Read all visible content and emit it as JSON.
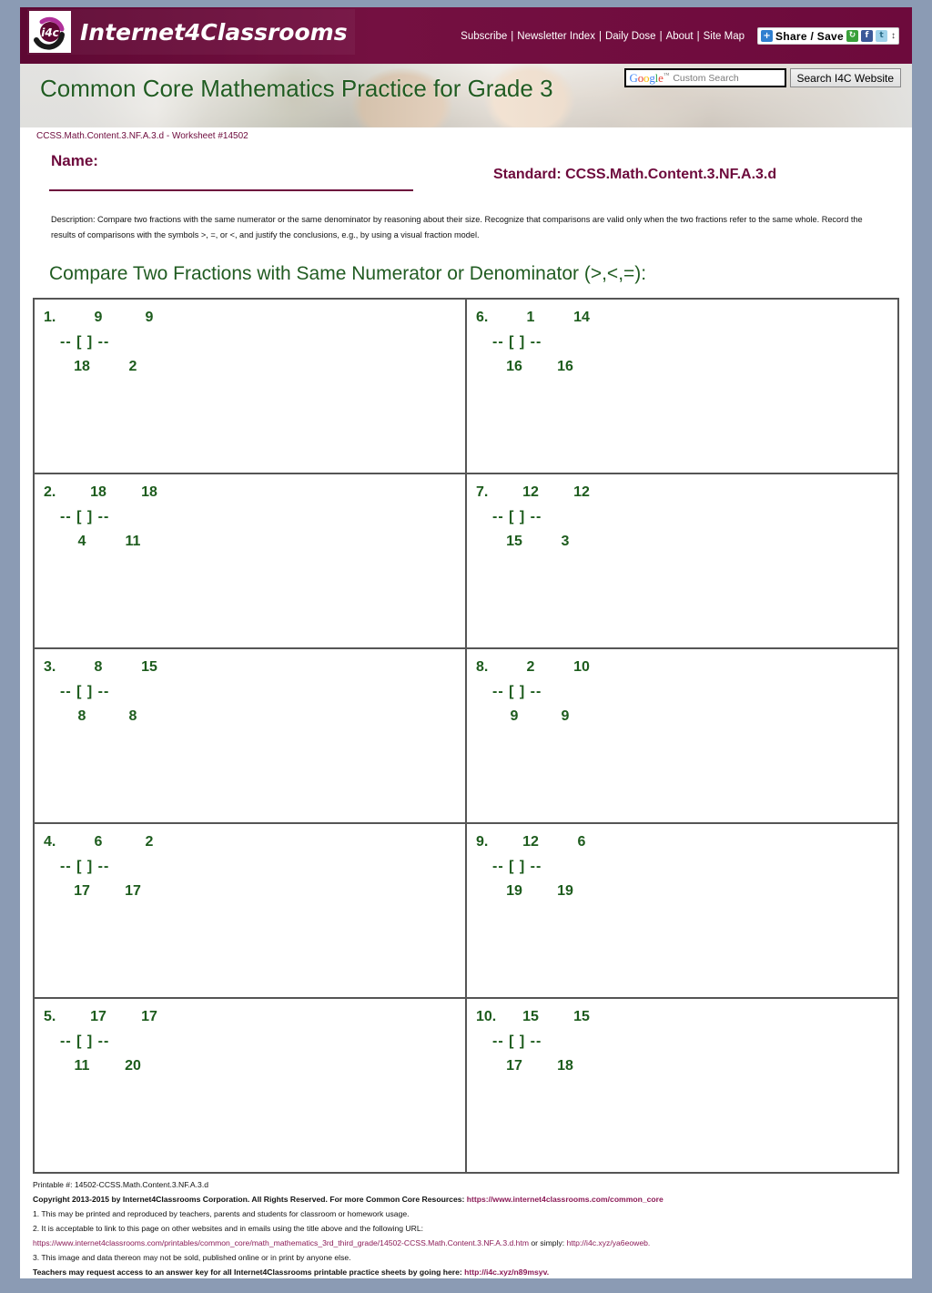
{
  "site": {
    "logo_text": "Internet4Classrooms",
    "logo_badge": "i4c",
    "nav": [
      {
        "label": "Subscribe"
      },
      {
        "label": "Newsletter Index"
      },
      {
        "label": "Daily Dose"
      },
      {
        "label": "About"
      },
      {
        "label": "Site Map"
      }
    ],
    "share": {
      "label": "Share / Save",
      "plus": "+",
      "icons": [
        "share2-icon",
        "facebook-icon",
        "twitter-icon",
        "updown-arrows-icon"
      ]
    },
    "search": {
      "brand": "Google",
      "tm": "™",
      "placeholder": "Custom Search",
      "value": "",
      "button_label": "Search I4C Website"
    }
  },
  "banner": {
    "title": "Common Core Mathematics Practice for Grade 3"
  },
  "worksheet": {
    "id_line": "CCSS.Math.Content.3.NF.A.3.d - Worksheet #14502",
    "name_label": "Name:",
    "standard": "Standard: CCSS.Math.Content.3.NF.A.3.d",
    "description": "Description: Compare two fractions with the same numerator or the same denominator by reasoning about their size. Recognize that comparisons are valid only when the two fractions refer to the same whole. Record the results of comparisons with the symbols >, =, or <, and justify the conclusions, e.g., by using a visual fraction model.",
    "section_title": "Compare Two Fractions with Same Numerator or Denominator (>,<,=):",
    "operator_placeholder": "[ ]",
    "bar": "--"
  },
  "problems": [
    {
      "num": "1.",
      "n1": "9",
      "d1": "18",
      "n2": "9",
      "d2": "2"
    },
    {
      "num": "2.",
      "n1": "18",
      "d1": "4",
      "n2": "18",
      "d2": "11"
    },
    {
      "num": "3.",
      "n1": "8",
      "d1": "8",
      "n2": "15",
      "d2": "8"
    },
    {
      "num": "4.",
      "n1": "6",
      "d1": "17",
      "n2": "2",
      "d2": "17"
    },
    {
      "num": "5.",
      "n1": "17",
      "d1": "11",
      "n2": "17",
      "d2": "20"
    },
    {
      "num": "6.",
      "n1": "1",
      "d1": "16",
      "n2": "14",
      "d2": "16"
    },
    {
      "num": "7.",
      "n1": "12",
      "d1": "15",
      "n2": "12",
      "d2": "3"
    },
    {
      "num": "8.",
      "n1": "2",
      "d1": "9",
      "n2": "10",
      "d2": "9"
    },
    {
      "num": "9.",
      "n1": "12",
      "d1": "19",
      "n2": "6",
      "d2": "19"
    },
    {
      "num": "10.",
      "n1": "15",
      "d1": "17",
      "n2": "15",
      "d2": "18"
    }
  ],
  "footer": {
    "printable": "Printable #: 14502-CCSS.Math.Content.3.NF.A.3.d",
    "copyright_text": "Copyright 2013-2015 by Internet4Classrooms Corporation. All Rights Reserved. For more Common Core Resources:",
    "copyright_link": "https://www.internet4classrooms.com/common_core",
    "note1": "1. This may be printed and reproduced by teachers, parents and students for classroom or homework usage.",
    "note2": "2. It is acceptable to link to this page on other websites and in emails using the title above and the following URL:",
    "url_line_a": "https://www.internet4classrooms.com/printables/common_core/math_mathematics_3rd_third_grade/14502-CCSS.Math.Content.3.NF.A.3.d.htm",
    "url_line_mid": " or simply: ",
    "url_line_b": "http://i4c.xyz/ya6eoweb.",
    "note3": "3. This image and data thereon may not be sold, published online or in print by anyone else.",
    "answer_key_text": "Teachers may request access to an answer key for all Internet4Classrooms printable practice sheets by going here:",
    "answer_key_link": "http://i4c.xyz/n89msyv."
  },
  "colors": {
    "maroon": "#6d0a3c",
    "green": "#1d5c1d",
    "banner_green": "#215c22",
    "page_bg": "#8b9bb4",
    "link": "#8b1a56"
  }
}
